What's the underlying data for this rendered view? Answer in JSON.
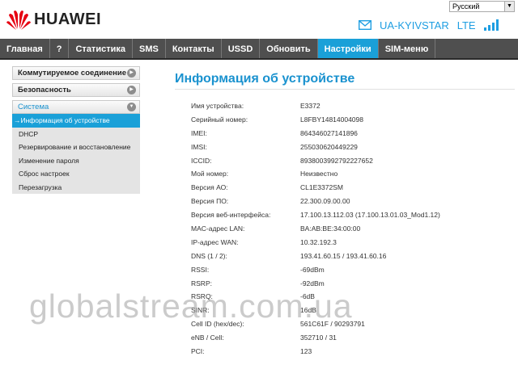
{
  "header": {
    "brand": "HUAWEI",
    "language": "Русский",
    "operator": "UA-KYIVSTAR",
    "network_type": "LTE",
    "icons": [
      "huawei-logo",
      "envelope-icon",
      "signal-icon"
    ]
  },
  "nav": {
    "items": [
      "Главная",
      "?",
      "Статистика",
      "SMS",
      "Контакты",
      "USSD",
      "Обновить",
      "Настройки",
      "SIM-меню"
    ],
    "active": "Настройки"
  },
  "sidebar": {
    "groups": [
      "Коммутируемое соединение",
      "Безопасность",
      "Система"
    ],
    "open_group": "Система",
    "sub_items": [
      "→Информация об устройстве",
      "DHCP",
      "Резервирование и восстановление",
      "Изменение пароля",
      "Сброс настроек",
      "Перезагрузка"
    ]
  },
  "main": {
    "title": "Информация об устройстве",
    "rows": [
      {
        "label": "Имя устройства:",
        "value": "E3372"
      },
      {
        "label": "Серийный номер:",
        "value": "L8FBY14814004098"
      },
      {
        "label": "IMEI:",
        "value": "864346027141896"
      },
      {
        "label": "IMSI:",
        "value": "255030620449229"
      },
      {
        "label": "ICCID:",
        "value": "8938003992792227652"
      },
      {
        "label": "Мой номер:",
        "value": "Неизвестно"
      },
      {
        "label": "Версия АО:",
        "value": "CL1E3372SM"
      },
      {
        "label": "Версия ПО:",
        "value": "22.300.09.00.00"
      },
      {
        "label": "Версия веб-интерфейса:",
        "value": "17.100.13.112.03 (17.100.13.01.03_Mod1.12)"
      },
      {
        "label": "MAC-адрес LAN:",
        "value": "BA:AB:BE:34:00:00"
      },
      {
        "label": "IP-адрес WAN:",
        "value": "10.32.192.3"
      },
      {
        "label": "DNS (1 / 2):",
        "value": "193.41.60.15 / 193.41.60.16"
      },
      {
        "label": "RSSI:",
        "value": "-69dBm"
      },
      {
        "label": "RSRP:",
        "value": "-92dBm"
      },
      {
        "label": "RSRQ:",
        "value": "-6dB"
      },
      {
        "label": "SINR:",
        "value": "16dB"
      },
      {
        "label": "Cell ID (hex/dec):",
        "value": "561C61F / 90293791"
      },
      {
        "label": "eNB / Cell:",
        "value": "352710 / 31"
      },
      {
        "label": "PCI:",
        "value": "123"
      }
    ]
  },
  "watermark": "globalstream.com.ua",
  "colors": {
    "accent": "#1aa0d8",
    "nav_bg": "#4f4f4f",
    "title": "#1a92cf",
    "logo_red": "#e60012"
  }
}
